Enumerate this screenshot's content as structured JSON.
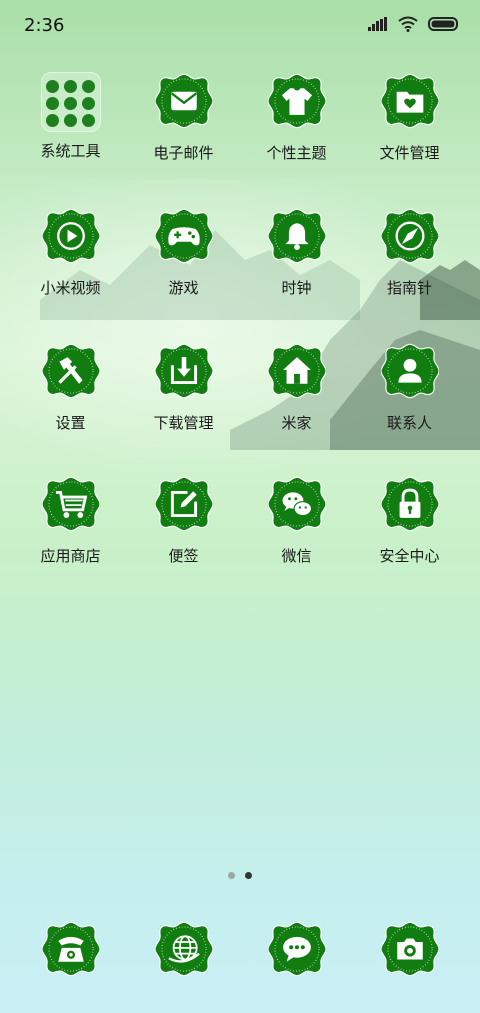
{
  "status": {
    "time": "2:36"
  },
  "apps": [
    {
      "label": "系统工具",
      "icon": "folder-icon"
    },
    {
      "label": "电子邮件",
      "icon": "mail-icon"
    },
    {
      "label": "个性主题",
      "icon": "tshirt-icon"
    },
    {
      "label": "文件管理",
      "icon": "file-manager-icon"
    },
    {
      "label": "小米视频",
      "icon": "video-play-icon"
    },
    {
      "label": "游戏",
      "icon": "gamepad-icon"
    },
    {
      "label": "时钟",
      "icon": "bell-icon"
    },
    {
      "label": "指南针",
      "icon": "compass-icon"
    },
    {
      "label": "设置",
      "icon": "hammer-icon"
    },
    {
      "label": "下载管理",
      "icon": "download-icon"
    },
    {
      "label": "米家",
      "icon": "home-icon"
    },
    {
      "label": "联系人",
      "icon": "person-icon"
    },
    {
      "label": "应用商店",
      "icon": "cart-icon"
    },
    {
      "label": "便签",
      "icon": "note-edit-icon"
    },
    {
      "label": "微信",
      "icon": "wechat-icon"
    },
    {
      "label": "安全中心",
      "icon": "lock-icon"
    }
  ],
  "dock": [
    {
      "icon": "phone-icon"
    },
    {
      "icon": "browser-globe-icon"
    },
    {
      "icon": "message-icon"
    },
    {
      "icon": "camera-icon"
    }
  ],
  "pages": {
    "count": 2,
    "active": 2
  },
  "colors": {
    "accent": "#117d11",
    "dark": "#0c6a0c"
  }
}
